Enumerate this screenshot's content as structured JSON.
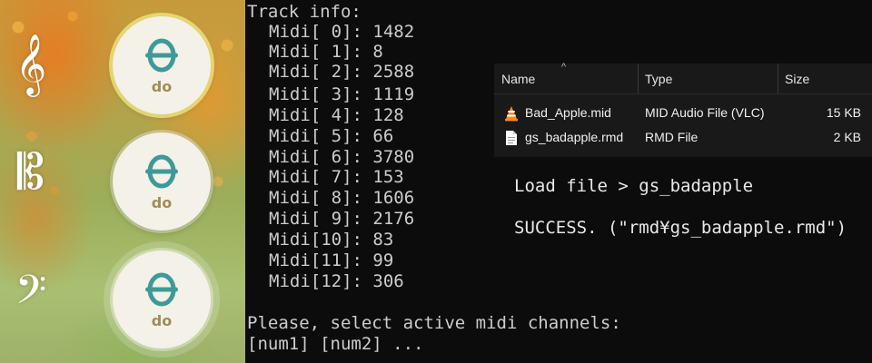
{
  "game": {
    "clefs": [
      {
        "name": "treble",
        "glyph": "𝄞"
      },
      {
        "name": "alto",
        "glyph": "𝄡"
      },
      {
        "name": "bass",
        "glyph": "𝄢"
      }
    ],
    "note_buttons": [
      {
        "label": "do"
      },
      {
        "label": "do"
      },
      {
        "label": "do"
      }
    ],
    "accent_color": "#3e9a98"
  },
  "console": {
    "header": "Track info:",
    "tracks": [
      "Midi[ 0]: 1482",
      "Midi[ 1]: 8",
      "Midi[ 2]: 2588",
      "Midi[ 3]: 1119",
      "Midi[ 4]: 128",
      "Midi[ 5]: 66",
      "Midi[ 6]: 3780",
      "Midi[ 7]: 153",
      "Midi[ 8]: 1606",
      "Midi[ 9]: 2176",
      "Midi[10]: 83",
      "Midi[11]: 99",
      "Midi[12]: 306"
    ],
    "prompt_line1": "Please, select active midi channels:",
    "prompt_line2": "[num1] [num2] ..."
  },
  "explorer": {
    "columns": {
      "name": "Name",
      "type": "Type",
      "size": "Size"
    },
    "files": [
      {
        "name": "Bad_Apple.mid",
        "type": "MID Audio File (VLC)",
        "size": "15 KB",
        "icon": "vlc-cone-icon"
      },
      {
        "name": "gs_badapple.rmd",
        "type": "RMD File",
        "size": "2 KB",
        "icon": "document-icon"
      }
    ]
  },
  "messages": {
    "load": "Load file > gs_badapple",
    "success": "SUCCESS. (\"rmd¥gs_badapple.rmd\")"
  }
}
